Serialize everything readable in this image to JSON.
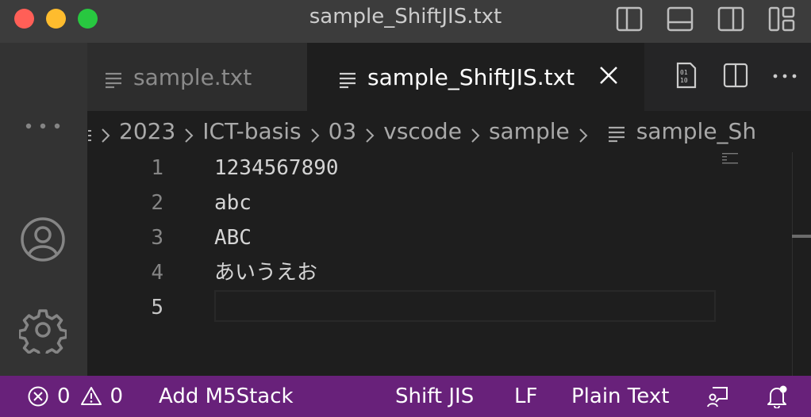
{
  "window": {
    "title": "sample_ShiftJIS.txt",
    "layout_icons": [
      "toggle-primary-sidebar-icon",
      "toggle-panel-icon",
      "toggle-secondary-sidebar-icon",
      "customize-layout-icon"
    ]
  },
  "activity_bar": {
    "more_label": "...",
    "items": [
      "accounts-icon",
      "manage-gear-icon"
    ]
  },
  "tabs": [
    {
      "label": "sample.txt",
      "active": false
    },
    {
      "label": "sample_ShiftJIS.txt",
      "active": true
    }
  ],
  "tab_actions": [
    "open-changes-icon",
    "split-editor-icon",
    "more-actions-icon"
  ],
  "breadcrumb": [
    "2023",
    "ICT-basis",
    "03",
    "vscode",
    "sample",
    "sample_Sh"
  ],
  "editor": {
    "lines": [
      {
        "number": "1",
        "text": "1234567890"
      },
      {
        "number": "2",
        "text": "abc"
      },
      {
        "number": "3",
        "text": "ABC"
      },
      {
        "number": "4",
        "text": "あいうえお"
      },
      {
        "number": "5",
        "text": ""
      }
    ],
    "current_line": "5"
  },
  "statusbar": {
    "errors": "0",
    "warnings": "0",
    "add_m5stack": "Add M5Stack",
    "encoding": "Shift JIS",
    "eol": "LF",
    "language": "Plain Text"
  },
  "colors": {
    "statusbar": "#68217a",
    "editor_bg": "#1e1e1e",
    "titlebar": "#3c3c3c",
    "activitybar": "#333333"
  }
}
